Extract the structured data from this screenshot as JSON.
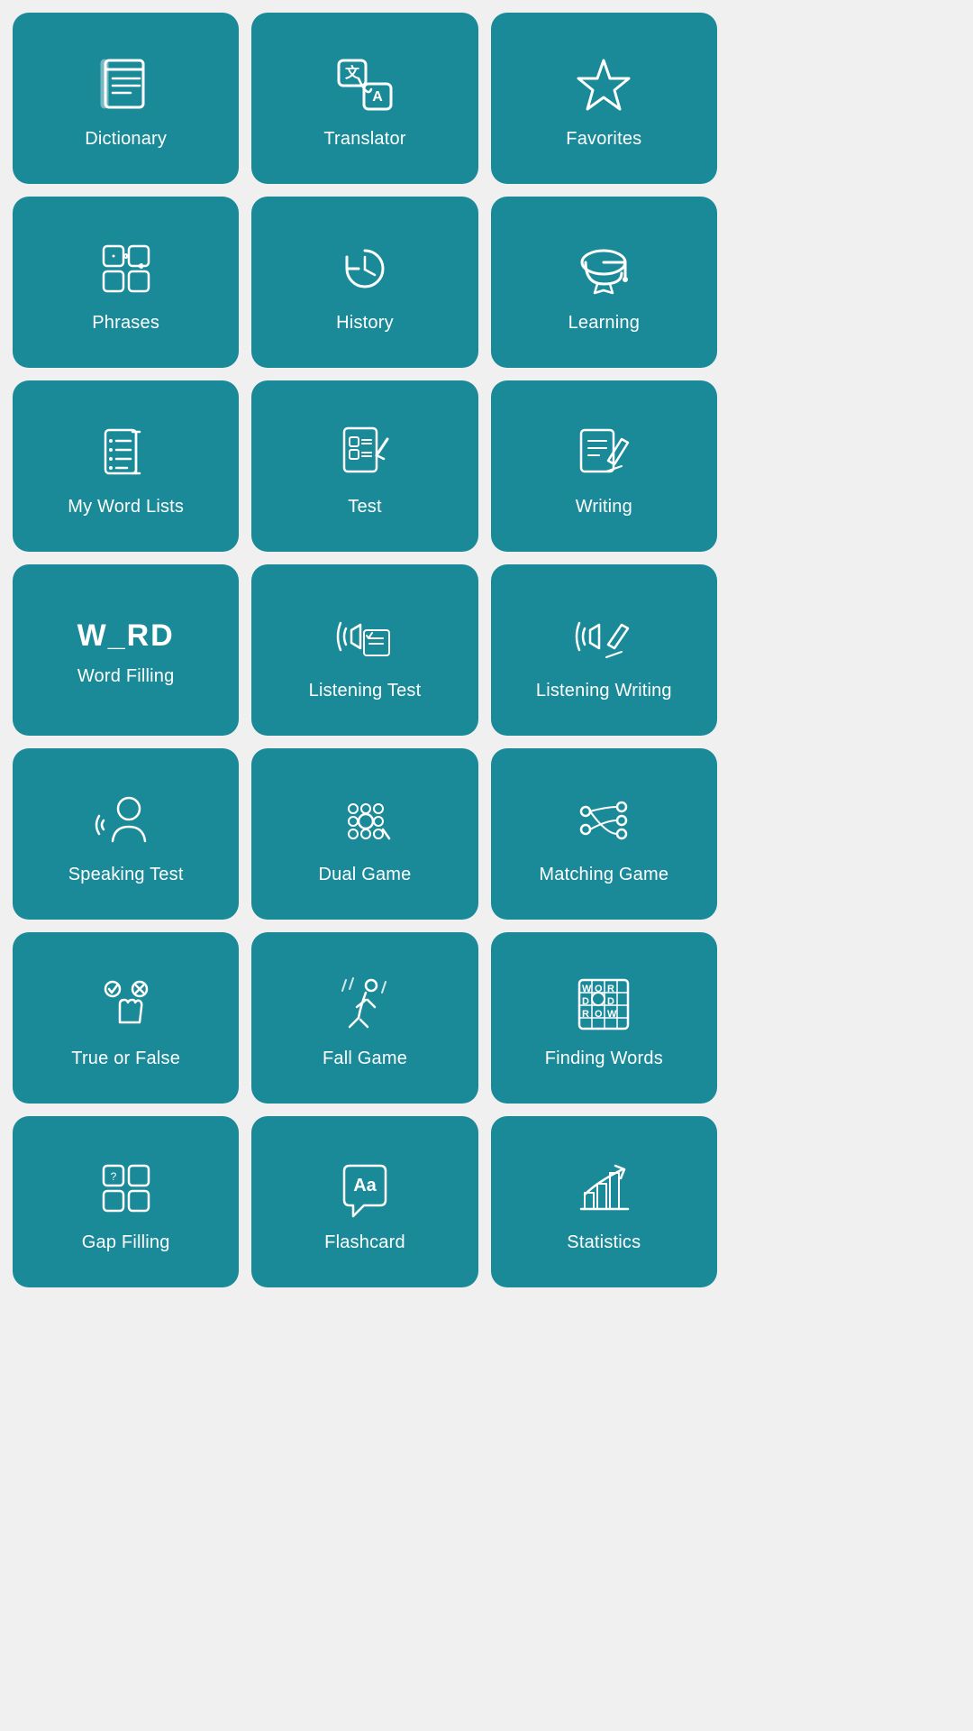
{
  "tiles": [
    {
      "id": "dictionary",
      "label": "Dictionary",
      "icon": "dictionary"
    },
    {
      "id": "translator",
      "label": "Translator",
      "icon": "translator"
    },
    {
      "id": "favorites",
      "label": "Favorites",
      "icon": "favorites"
    },
    {
      "id": "phrases",
      "label": "Phrases",
      "icon": "phrases"
    },
    {
      "id": "history",
      "label": "History",
      "icon": "history"
    },
    {
      "id": "learning",
      "label": "Learning",
      "icon": "learning"
    },
    {
      "id": "my-word-lists",
      "label": "My Word Lists",
      "icon": "wordlists"
    },
    {
      "id": "test",
      "label": "Test",
      "icon": "test"
    },
    {
      "id": "writing",
      "label": "Writing",
      "icon": "writing"
    },
    {
      "id": "word-filling",
      "label": "Word Filling",
      "icon": "wordfilling"
    },
    {
      "id": "listening-test",
      "label": "Listening Test",
      "icon": "listeningtest"
    },
    {
      "id": "listening-writing",
      "label": "Listening Writing",
      "icon": "listeningwriting"
    },
    {
      "id": "speaking-test",
      "label": "Speaking Test",
      "icon": "speakingtest"
    },
    {
      "id": "dual-game",
      "label": "Dual Game",
      "icon": "dualgame"
    },
    {
      "id": "matching-game",
      "label": "Matching Game",
      "icon": "matchinggame"
    },
    {
      "id": "true-or-false",
      "label": "True or False",
      "icon": "trueorfalse"
    },
    {
      "id": "fall-game",
      "label": "Fall Game",
      "icon": "fallgame"
    },
    {
      "id": "finding-words",
      "label": "Finding Words",
      "icon": "findingwords"
    },
    {
      "id": "gap-filling",
      "label": "Gap Filling",
      "icon": "gapfilling"
    },
    {
      "id": "flashcard",
      "label": "Flashcard",
      "icon": "flashcard"
    },
    {
      "id": "statistics",
      "label": "Statistics",
      "icon": "statistics"
    }
  ]
}
